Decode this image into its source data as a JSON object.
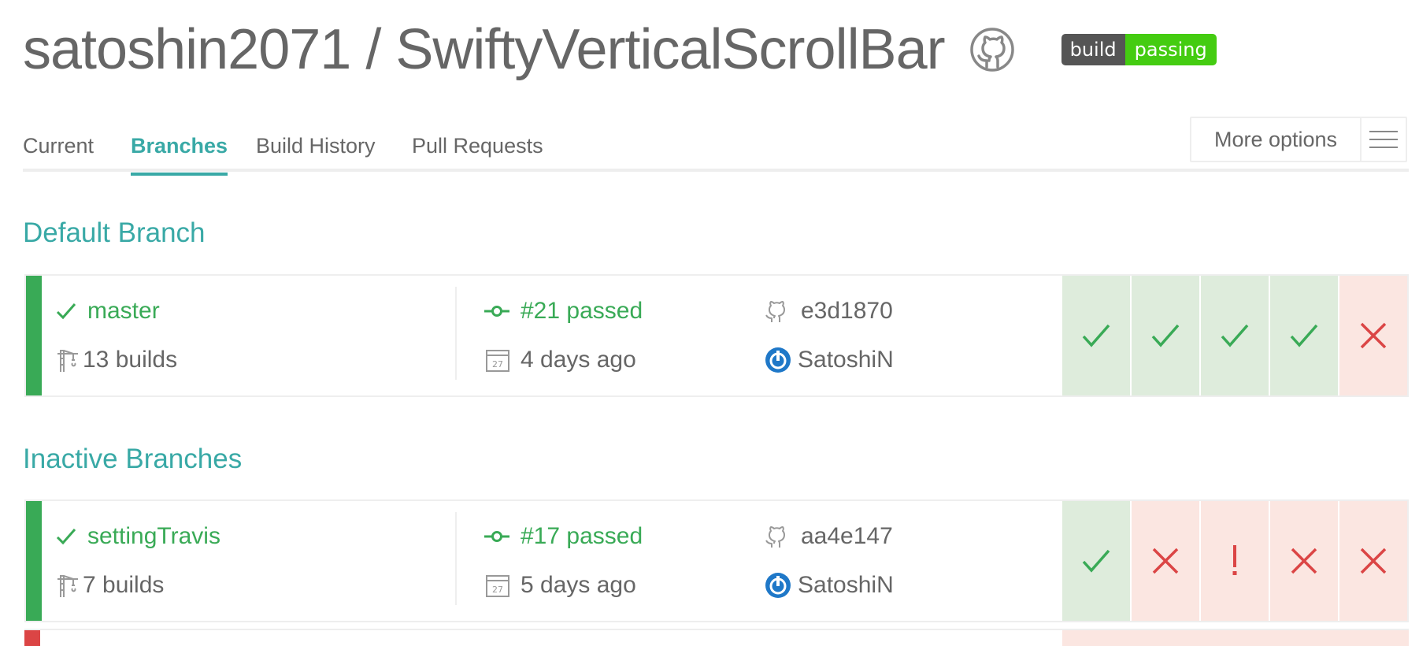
{
  "repo": {
    "owner": "satoshin2071",
    "separator": "/",
    "name": "SwiftyVerticalScrollBar",
    "github_icon": "github-icon"
  },
  "badge": {
    "left": "build",
    "right": "passing",
    "left_color": "#555555",
    "right_color": "#44cc11"
  },
  "tabs": [
    {
      "label": "Current",
      "active": false
    },
    {
      "label": "Branches",
      "active": true
    },
    {
      "label": "Build History",
      "active": false
    },
    {
      "label": "Pull Requests",
      "active": false
    }
  ],
  "more_options": {
    "label": "More options",
    "icon": "hamburger-icon"
  },
  "sections": {
    "default": {
      "title": "Default Branch",
      "branch": {
        "name": "master",
        "builds": "13 builds",
        "build_number": "#21 passed",
        "time": "4 days ago",
        "commit": "e3d1870",
        "author": "SatoshiN",
        "history": [
          "passed",
          "passed",
          "passed",
          "passed",
          "failed"
        ]
      }
    },
    "inactive": {
      "title": "Inactive Branches",
      "branch": {
        "name": "settingTravis",
        "builds": "7 builds",
        "build_number": "#17 passed",
        "time": "5 days ago",
        "commit": "aa4e147",
        "author": "SatoshiN",
        "history": [
          "passed",
          "failed",
          "errored",
          "failed",
          "failed"
        ]
      }
    }
  },
  "colors": {
    "accent": "#39a9a6",
    "passed": "#39aa56",
    "failed": "#db4545",
    "passed_bg": "#deecdc",
    "failed_bg": "#fbe6e1"
  }
}
